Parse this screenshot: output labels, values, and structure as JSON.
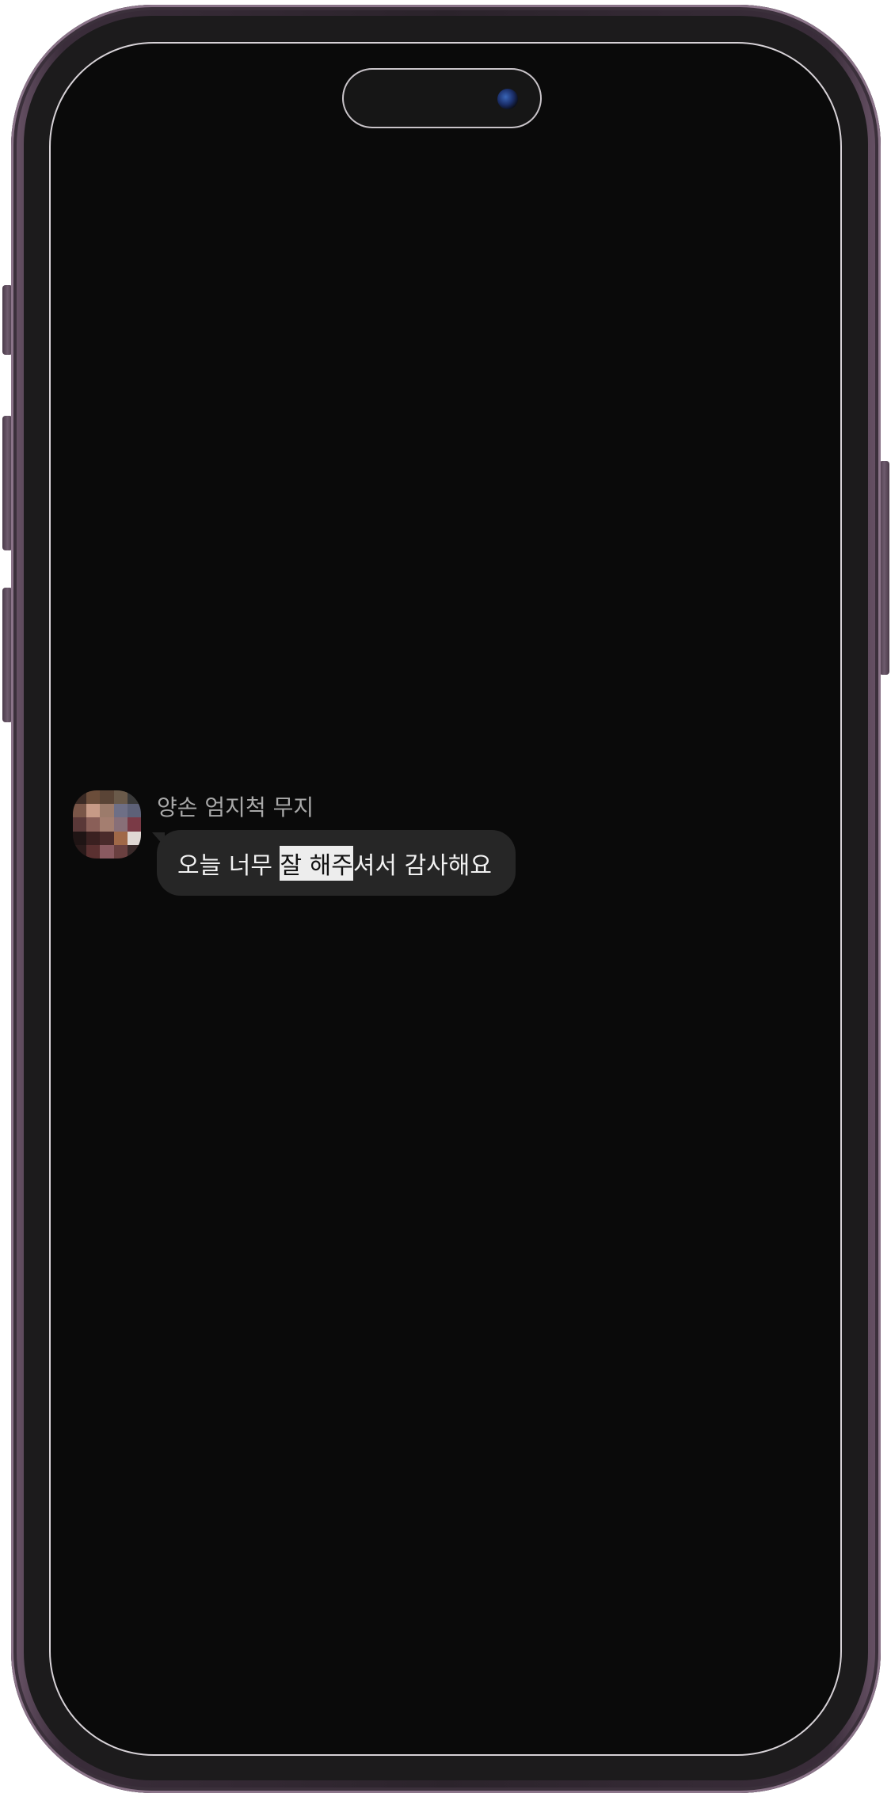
{
  "message": {
    "sender_name": "양손 엄지척 무지",
    "text_before": "오늘 너무 ",
    "text_highlight": "잘 해주",
    "text_after": "셔서 감사해요"
  },
  "colors": {
    "screen_background": "#0a0a0a",
    "bubble_background": "#262626",
    "sender_name_color": "#a9a9a9",
    "message_text_color": "#f2f2f2",
    "highlight_background": "#ededed",
    "phone_frame": "#2b232b"
  },
  "avatar": {
    "style": "pixelated",
    "pixels": [
      "#3b2a24",
      "#6b4d3a",
      "#5a4436",
      "#6a5a4a",
      "#3a3a3a",
      "#7a5648",
      "#c79a86",
      "#9c7b6b",
      "#6e6f86",
      "#5d6178",
      "#5a3838",
      "#8a5f58",
      "#a47e70",
      "#886f78",
      "#7a3a46",
      "#1f1414",
      "#3a2020",
      "#4a2b2b",
      "#a06848",
      "#e0d8d4",
      "#2a1a1a",
      "#5a3030",
      "#8a5a60",
      "#6a4040",
      "#3a2a2a"
    ]
  },
  "icons": {
    "front_camera": "camera-icon"
  }
}
